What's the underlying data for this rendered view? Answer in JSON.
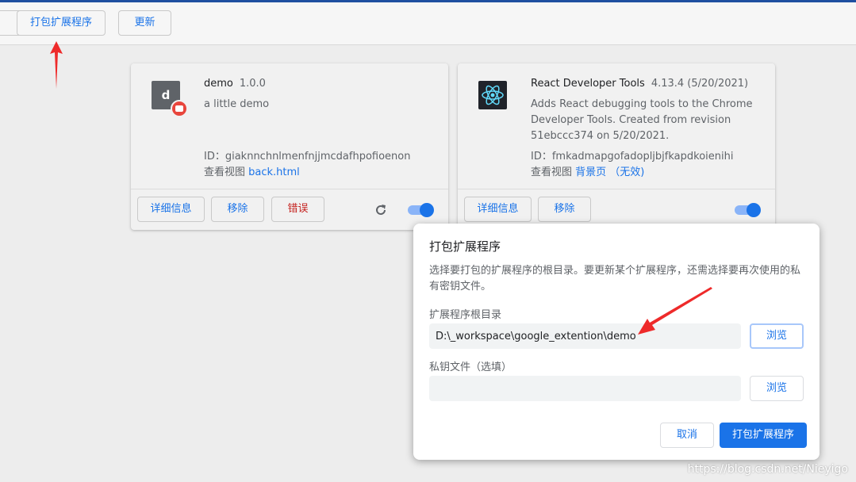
{
  "toolbar": {
    "pack_label": "打包扩展程序",
    "update_label": "更新"
  },
  "extensions": [
    {
      "name": "demo",
      "version": "1.0.0",
      "description": "a little demo",
      "id_text": "ID：giaknnchnlmenfnjjmcdafhpofioenon",
      "view_prefix": "查看视图",
      "view_link": "back.html",
      "details_label": "详细信息",
      "remove_label": "移除",
      "errors_label": "错误",
      "icon_letter": "d"
    },
    {
      "name": "React Developer Tools",
      "version": "4.13.4 (5/20/2021)",
      "description": "Adds React debugging tools to the Chrome Developer Tools. Created from revision 51ebccc374 on 5/20/2021.",
      "id_text": "ID：fmkadmapgofadopljbjfkapdkoienihi",
      "view_prefix": "查看视图",
      "view_link": "背景页 （无效)",
      "details_label": "详细信息",
      "remove_label": "移除"
    }
  ],
  "dialog": {
    "title": "打包扩展程序",
    "description": "选择要打包的扩展程序的根目录。要更新某个扩展程序，还需选择要再次使用的私有密钥文件。",
    "root_label": "扩展程序根目录",
    "root_value": "D:\\_workspace\\google_extention\\demo",
    "key_label": "私钥文件（选填）",
    "key_value": "",
    "browse_label": "浏览",
    "cancel_label": "取消",
    "confirm_label": "打包扩展程序"
  },
  "watermark": "https://blog.csdn.net/Nieyigo",
  "colors": {
    "accent": "#1a73e8",
    "error": "#c5221f",
    "annotation_arrow": "#ee2a2a"
  }
}
